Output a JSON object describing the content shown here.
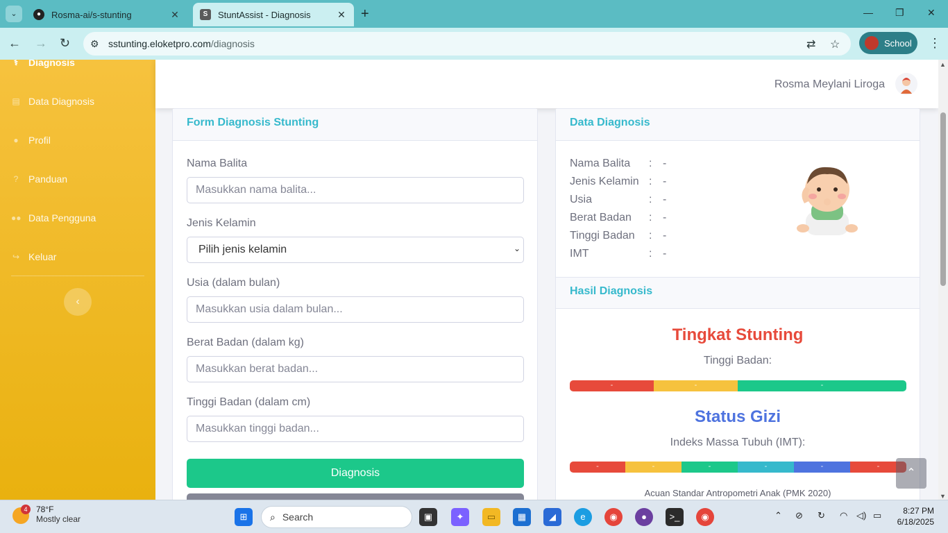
{
  "browser": {
    "tabs": [
      {
        "title": "Rosma-ai/s-stunting",
        "active": false
      },
      {
        "title": "StuntAssist - Diagnosis",
        "active": true
      }
    ],
    "url_domain": "sstunting.eloketpro.com",
    "url_path": "/diagnosis",
    "profile_label": "School"
  },
  "sidebar": {
    "items": [
      {
        "label": "Diagnosis",
        "icon": "stethoscope-icon",
        "active": true
      },
      {
        "label": "Data Diagnosis",
        "icon": "file-icon"
      },
      {
        "label": "Profil",
        "icon": "user-icon"
      },
      {
        "label": "Panduan",
        "icon": "question-icon"
      },
      {
        "label": "Data Pengguna",
        "icon": "users-icon"
      },
      {
        "label": "Keluar",
        "icon": "sign-out-icon"
      }
    ]
  },
  "topbar": {
    "user_name": "Rosma Meylani Liroga"
  },
  "form": {
    "title": "Form Diagnosis Stunting",
    "fields": [
      {
        "label": "Nama Balita",
        "placeholder": "Masukkan nama balita..."
      },
      {
        "label": "Jenis Kelamin",
        "selected": "Pilih jenis kelamin"
      },
      {
        "label": "Usia (dalam bulan)",
        "placeholder": "Masukkan usia dalam bulan..."
      },
      {
        "label": "Berat Badan (dalam kg)",
        "placeholder": "Masukkan berat badan..."
      },
      {
        "label": "Tinggi Badan (dalam cm)",
        "placeholder": "Masukkan tinggi badan..."
      }
    ],
    "submit_label": "Diagnosis"
  },
  "data_diagnosis": {
    "title": "Data Diagnosis",
    "rows": [
      {
        "key": "Nama Balita",
        "sep": ":",
        "value": "-"
      },
      {
        "key": "Jenis Kelamin",
        "sep": ":",
        "value": "-"
      },
      {
        "key": "Usia",
        "sep": ":",
        "value": "-"
      },
      {
        "key": "Berat Badan",
        "sep": ":",
        "value": "-"
      },
      {
        "key": "Tinggi Badan",
        "sep": ":",
        "value": "-"
      },
      {
        "key": "IMT",
        "sep": ":",
        "value": "-"
      }
    ]
  },
  "hasil": {
    "title": "Hasil Diagnosis",
    "stunting_title": "Tingkat Stunting",
    "stunting_sub": "Tinggi Badan:",
    "stunting_bar": [
      "-",
      "-",
      "-"
    ],
    "gizi_title": "Status Gizi",
    "gizi_sub": "Indeks Massa Tubuh (IMT):",
    "gizi_bar": [
      "-",
      "-",
      "-",
      "-",
      "-",
      "-"
    ],
    "acuan": "Acuan Standar Antropometri Anak (PMK 2020)"
  },
  "colors": {
    "primary_yellow": "#f6c23e",
    "info": "#36b9cc",
    "danger": "#e74a3b",
    "success": "#1cc88a",
    "primary": "#4e73df"
  },
  "taskbar": {
    "weather_temp": "78°F",
    "weather_desc": "Mostly clear",
    "weather_badge": "4",
    "search_label": "Search",
    "time": "8:27 PM",
    "date": "6/18/2025"
  }
}
